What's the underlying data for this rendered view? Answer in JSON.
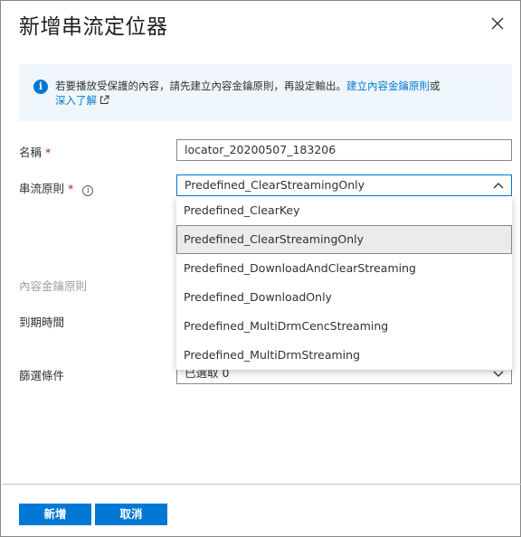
{
  "dialog": {
    "title": "新增串流定位器"
  },
  "info": {
    "text": "若要播放受保護的內容，請先建立內容金鑰原則，再設定輸出。",
    "link1": "建立內容金鑰原則",
    "suffix": "或",
    "link2": "深入了解"
  },
  "form": {
    "name_label": "名稱",
    "name_required": "*",
    "name_value": "locator_20200507_183206",
    "policy_label": "串流原則",
    "policy_required": "*",
    "policy_value": "Predefined_ClearStreamingOnly",
    "content_key_label": "內容金鑰原則",
    "expiry_label": "到期時間",
    "filter_label": "篩選條件",
    "filter_value": "已選取 0"
  },
  "dropdown": {
    "options": [
      "Predefined_ClearKey",
      "Predefined_ClearStreamingOnly",
      "Predefined_DownloadAndClearStreaming",
      "Predefined_DownloadOnly",
      "Predefined_MultiDrmCencStreaming",
      "Predefined_MultiDrmStreaming"
    ],
    "selected_index": 1
  },
  "footer": {
    "add_label": "新增",
    "cancel_label": "取消"
  },
  "colors": {
    "accent": "#0078d4",
    "info_background": "#eff6fc",
    "required": "#a4262c",
    "selected_option": "#edebe9"
  },
  "icons": [
    "close-icon",
    "info-icon",
    "external-link-icon",
    "help-icon",
    "chevron-up-icon",
    "chevron-down-icon"
  ]
}
